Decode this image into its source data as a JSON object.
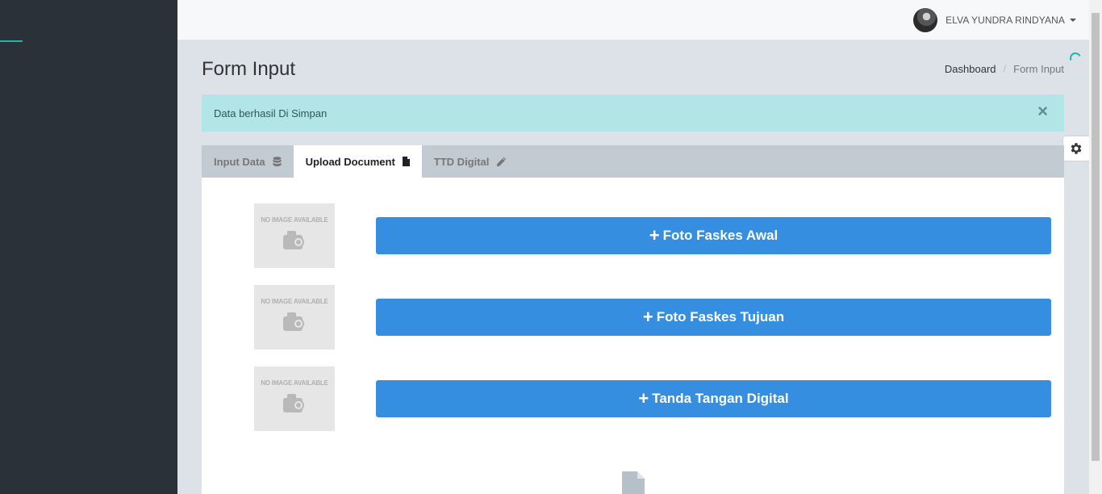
{
  "header": {
    "user_name": "ELVA YUNDRA RINDYANA"
  },
  "page": {
    "title": "Form Input",
    "breadcrumb": [
      "Dashboard",
      "Form Input"
    ]
  },
  "alert": {
    "message": "Data berhasil Di Simpan",
    "close_glyph": "×"
  },
  "tabs": [
    {
      "label": "Input Data",
      "icon": "database-icon",
      "active": false
    },
    {
      "label": "Upload Document",
      "icon": "file-icon",
      "active": true
    },
    {
      "label": "TTD Digital",
      "icon": "pencil-icon",
      "active": false
    }
  ],
  "uploads": [
    {
      "placeholder_text": "NO IMAGE AVAILABLE",
      "button_label": "Foto Faskes Awal"
    },
    {
      "placeholder_text": "NO IMAGE AVAILABLE",
      "button_label": "Foto Faskes Tujuan"
    },
    {
      "placeholder_text": "NO IMAGE AVAILABLE",
      "button_label": "Tanda Tangan Digital"
    }
  ],
  "colors": {
    "sidebar": "#2a3139",
    "accent": "#1fb5ac",
    "primary_button": "#358ee0",
    "alert_bg": "#b2e6e6"
  }
}
